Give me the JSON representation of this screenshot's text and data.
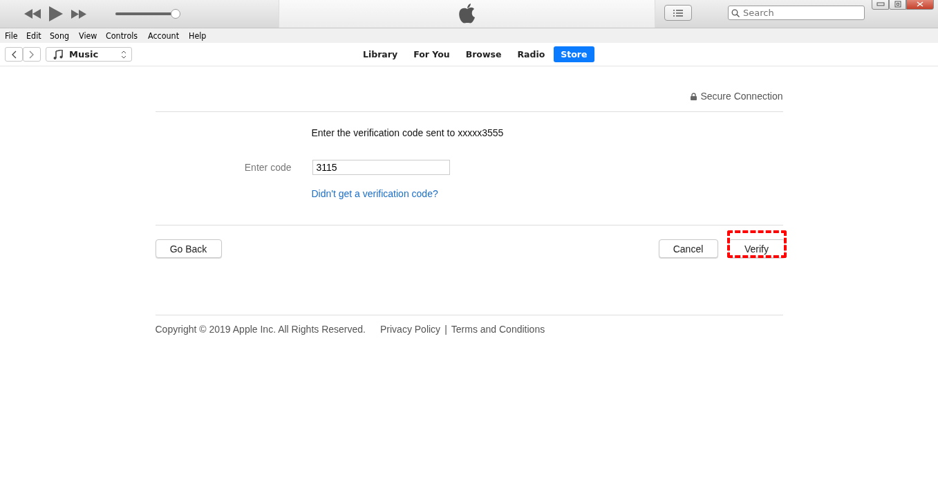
{
  "player": {
    "volume": {
      "level": 0.93
    }
  },
  "search": {
    "placeholder": "Search"
  },
  "menu": [
    "File",
    "Edit",
    "Song",
    "View",
    "Controls",
    "Account",
    "Help"
  ],
  "media_picker": {
    "value": "Music"
  },
  "tabs": [
    {
      "label": "Library",
      "selected": false
    },
    {
      "label": "For You",
      "selected": false
    },
    {
      "label": "Browse",
      "selected": false
    },
    {
      "label": "Radio",
      "selected": false
    },
    {
      "label": "Store",
      "selected": true
    }
  ],
  "secure_label": "Secure Connection",
  "prompt": "Enter the verification code sent to xxxxx3555",
  "code_field": {
    "label": "Enter code",
    "value": "3115"
  },
  "resend_link": "Didn't get a verification code?",
  "buttons": {
    "back": "Go Back",
    "cancel": "Cancel",
    "verify": {
      "label": "Verify",
      "highlighted": true
    }
  },
  "footer": {
    "copyright": "Copyright © 2019 Apple Inc. All Rights Reserved.",
    "links": [
      "Privacy Policy",
      "Terms and Conditions"
    ],
    "separator": "|"
  }
}
